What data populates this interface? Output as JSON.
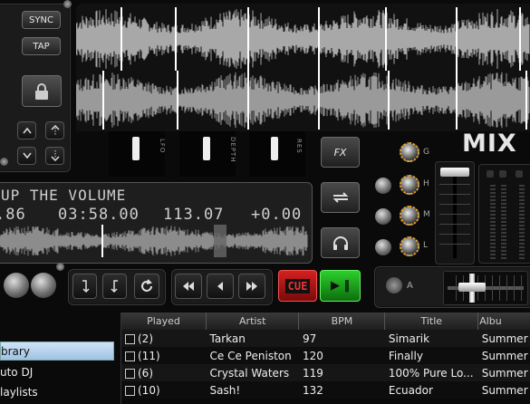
{
  "deck": {
    "sync_label": "SYNC",
    "tap_label": "TAP",
    "track_title": "UP THE VOLUME",
    "pitch": ".86",
    "time": "03:58.00",
    "bpm": "113.07",
    "pitch_offset": "+0.00",
    "cue_label": "CUE",
    "play_label": "▶ ‖"
  },
  "fx": {
    "slot_labels": [
      "LFO",
      "DEPTH",
      "RES"
    ],
    "fx_label": "FX"
  },
  "mixer": {
    "brand": "MIX",
    "eq_labels": [
      "G",
      "H",
      "M",
      "L"
    ],
    "a_label": "A"
  },
  "sidebar": {
    "items": [
      {
        "label": "Library",
        "display": "brary",
        "selected": true
      },
      {
        "label": "Auto DJ",
        "display": "uto DJ",
        "selected": false
      },
      {
        "label": "Playlists",
        "display": "laylists",
        "selected": false
      }
    ]
  },
  "library": {
    "columns": [
      "Played",
      "Artist",
      "BPM",
      "Title",
      "Albu"
    ],
    "rows": [
      {
        "played": "(2)",
        "artist": "Tarkan",
        "bpm": "97",
        "title": "Simarik",
        "album": "Summer"
      },
      {
        "played": "(11)",
        "artist": "Ce Ce Peniston",
        "bpm": "120",
        "title": "Finally",
        "album": "Summer"
      },
      {
        "played": "(6)",
        "artist": "Crystal Waters",
        "bpm": "119",
        "title": "100% Pure Lo...",
        "album": "Summer"
      },
      {
        "played": "(10)",
        "artist": "Sash!",
        "bpm": "132",
        "title": "Ecuador",
        "album": "Summer"
      }
    ]
  },
  "colors": {
    "cue": "#c01818",
    "play": "#1aa01a",
    "knob_ring": "#f5a623"
  }
}
